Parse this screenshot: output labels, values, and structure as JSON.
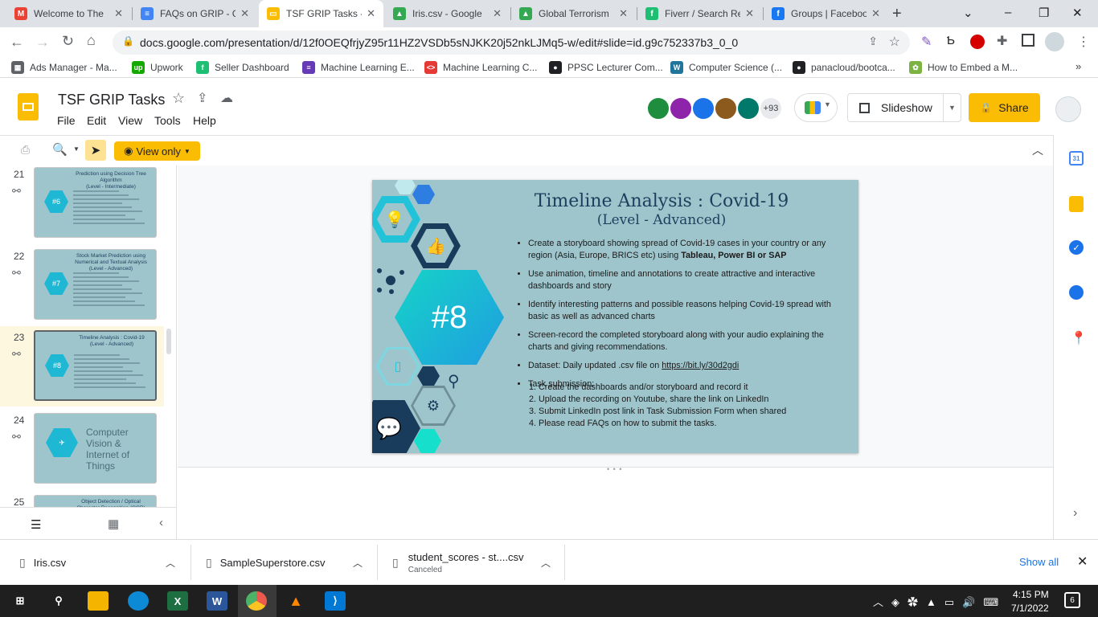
{
  "browser": {
    "tabs": [
      {
        "title": "Welcome to The",
        "icon": "gmail-icon",
        "color": "#ea4335",
        "glyph": "M"
      },
      {
        "title": "FAQs on GRIP - G",
        "icon": "docs-icon",
        "color": "#4285f4",
        "glyph": "≡"
      },
      {
        "title": "TSF GRIP Tasks -",
        "icon": "slides-icon",
        "color": "#fbbc04",
        "glyph": "▭"
      },
      {
        "title": "Iris.csv - Google",
        "icon": "drive-icon",
        "color": "#34a853",
        "glyph": "▲"
      },
      {
        "title": "Global Terrorism",
        "icon": "drive-icon",
        "color": "#34a853",
        "glyph": "▲"
      },
      {
        "title": "Fiverr / Search Re",
        "icon": "fiverr-icon",
        "color": "#1dbf73",
        "glyph": "f"
      },
      {
        "title": "Groups | Faceboo",
        "icon": "facebook-icon",
        "color": "#1877f2",
        "glyph": "f"
      }
    ],
    "url": "docs.google.com/presentation/d/12f0OEQfrjyZ95r11HZ2VSDb5sNJKK20j52nkLJMq5-w/edit#slide=id.g9c752337b3_0_0",
    "bookmarks": [
      {
        "label": "Ads Manager - Ma...",
        "icon": "ads-manager-icon",
        "color": "#5f6368",
        "glyph": "▦"
      },
      {
        "label": "Upwork",
        "icon": "upwork-icon",
        "color": "#14a800",
        "glyph": "up"
      },
      {
        "label": "Seller Dashboard",
        "icon": "fiverr-icon",
        "color": "#1dbf73",
        "glyph": "f"
      },
      {
        "label": "Machine Learning E...",
        "icon": "list-icon",
        "color": "#673ab7",
        "glyph": "≡"
      },
      {
        "label": "Machine Learning C...",
        "icon": "code-icon",
        "color": "#e53935",
        "glyph": "<>"
      },
      {
        "label": "PPSC Lecturer Com...",
        "icon": "globe-icon",
        "color": "#202124",
        "glyph": "●"
      },
      {
        "label": "Computer Science (...",
        "icon": "wordpress-icon",
        "color": "#21759b",
        "glyph": "W"
      },
      {
        "label": "panacloud/bootca...",
        "icon": "github-icon",
        "color": "#202124",
        "glyph": "●"
      },
      {
        "label": "How to Embed a M...",
        "icon": "leaf-icon",
        "color": "#7cb342",
        "glyph": "✿"
      }
    ]
  },
  "app": {
    "title": "TSF GRIP Tasks",
    "menu": [
      "File",
      "Edit",
      "View",
      "Tools",
      "Help"
    ],
    "collaborators_more": "+93",
    "slideshow_label": "Slideshow",
    "share_label": "Share",
    "view_only_label": "View only"
  },
  "filmstrip": [
    {
      "num": "21",
      "title": "Prediction using Decision Tree Algorithm\n(Level - Intermediate)",
      "badge": "#6"
    },
    {
      "num": "22",
      "title": "Stock Market Prediction using Numerical and Textual Analysis\n(Level - Advanced)",
      "badge": "#7"
    },
    {
      "num": "23",
      "title": "Timeline Analysis : Covid-19\n(Level - Advanced)",
      "badge": "#8"
    },
    {
      "num": "24",
      "title": "Computer Vision & Internet of Things",
      "badge": ""
    },
    {
      "num": "25",
      "title": "Object Detection / Optical Character Recognition (OCR)",
      "badge": ""
    }
  ],
  "slide": {
    "title": "Timeline Analysis : Covid-19",
    "subtitle": "(Level - Advanced)",
    "number": "#8",
    "bullet1_text": "Create a storyboard showing spread of Covid-19 cases in your country or any region (Asia, Europe, BRICS etc) using ",
    "bullet1_bold": "Tableau, Power BI or SAP",
    "bullet2": " Use animation, timeline and annotations to create attractive and interactive dashboards and story",
    "bullet3": "Identify interesting patterns and possible reasons helping Covid-19 spread with basic as well as advanced charts",
    "bullet4": "Screen-record the completed storyboard along with your audio explaining the charts and giving recommendations.",
    "bullet5_text": "Dataset: Daily updated .csv file on ",
    "bullet5_link": "https://bit.ly/30d2gdi",
    "bullet6": "Task submission:",
    "steps": [
      "1. Create the dashboards and/or storyboard and record it",
      "2. Upload the recording on Youtube, share the link on LinkedIn",
      "3. Submit LinkedIn post link in Task Submission Form when shared",
      "4. Please read FAQs on how to submit the tasks."
    ]
  },
  "downloads": [
    {
      "name": "Iris.csv",
      "status": ""
    },
    {
      "name": "SampleSuperstore.csv",
      "status": ""
    },
    {
      "name": "student_scores - st....csv",
      "status": "Canceled"
    }
  ],
  "downloads_show_all": "Show all",
  "taskbar": {
    "time": "4:15 PM",
    "date": "7/1/2022",
    "notification_count": "6"
  }
}
